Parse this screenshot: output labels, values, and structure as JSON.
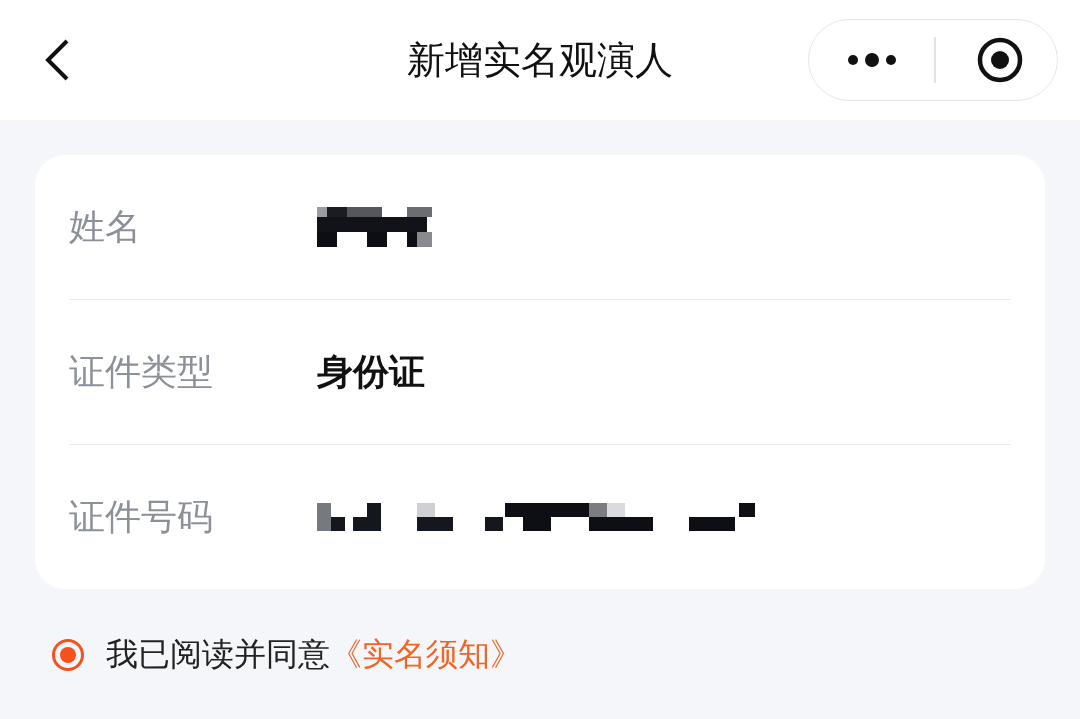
{
  "header": {
    "title": "新增实名观演人"
  },
  "fields": [
    {
      "label": "姓名",
      "kind": "redacted"
    },
    {
      "label": "证件类型",
      "kind": "text",
      "value": "身份证"
    },
    {
      "label": "证件号码",
      "kind": "redacted_long"
    }
  ],
  "agreement": {
    "checked": true,
    "text": "我已阅读并同意",
    "link": "《实名须知》"
  }
}
